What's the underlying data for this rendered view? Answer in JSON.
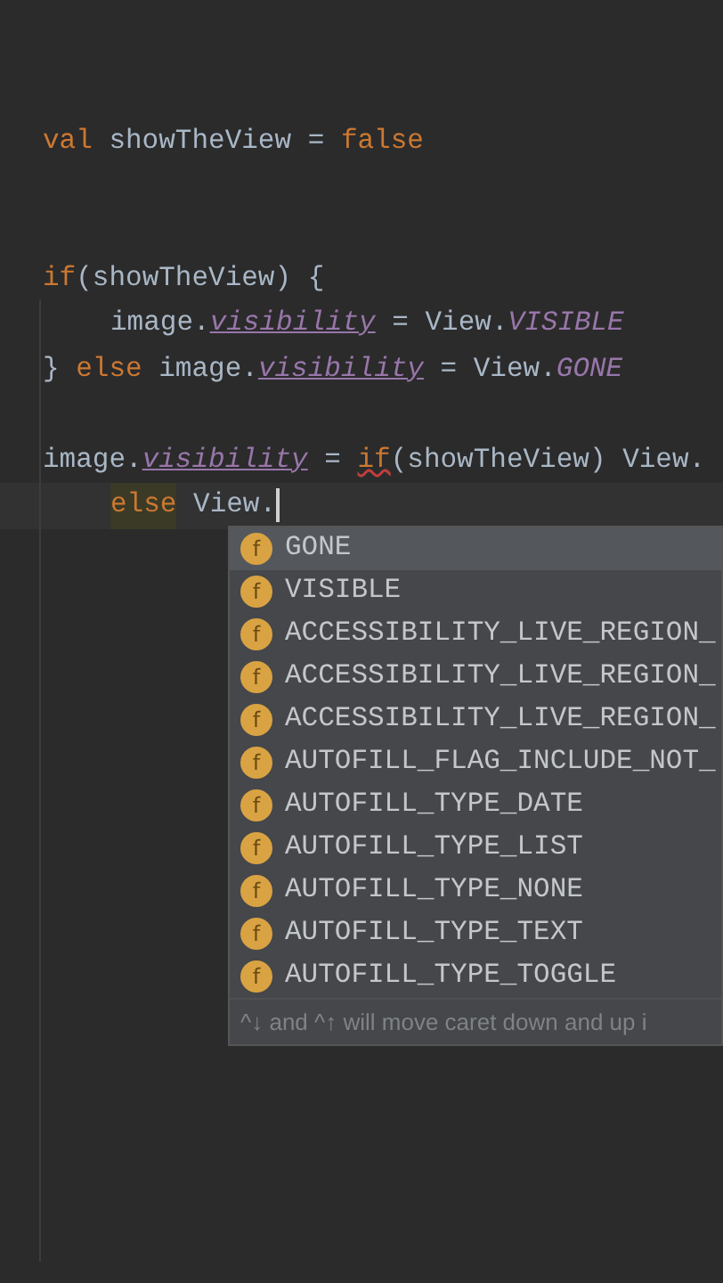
{
  "code_lines": [
    {
      "kind": "code",
      "current": false,
      "tokens": [
        {
          "text": "val",
          "kind": "keyword"
        },
        {
          "text": " showTheView = ",
          "kind": "text"
        },
        {
          "text": "false",
          "kind": "keyword"
        }
      ]
    },
    {
      "kind": "blank"
    },
    {
      "kind": "blank"
    },
    {
      "kind": "code",
      "current": false,
      "tokens": [
        {
          "text": "if",
          "kind": "keyword"
        },
        {
          "text": "(showTheView) {",
          "kind": "text"
        }
      ]
    },
    {
      "kind": "code",
      "current": false,
      "indented": true,
      "tokens": [
        {
          "text": "image.",
          "kind": "text"
        },
        {
          "text": "visibility",
          "kind": "property"
        },
        {
          "text": " = View.",
          "kind": "text"
        },
        {
          "text": "VISIBLE",
          "kind": "constant"
        }
      ]
    },
    {
      "kind": "code",
      "current": false,
      "tokens": [
        {
          "text": "} ",
          "kind": "text"
        },
        {
          "text": "else",
          "kind": "keyword"
        },
        {
          "text": " image.",
          "kind": "text"
        },
        {
          "text": "visibility",
          "kind": "property"
        },
        {
          "text": " = View.",
          "kind": "text"
        },
        {
          "text": "GONE",
          "kind": "constant"
        }
      ]
    },
    {
      "kind": "blank"
    },
    {
      "kind": "code",
      "current": false,
      "tokens": [
        {
          "text": "image.",
          "kind": "text"
        },
        {
          "text": "visibility",
          "kind": "property"
        },
        {
          "text": " = ",
          "kind": "text"
        },
        {
          "text": "if",
          "kind": "error_keyword"
        },
        {
          "text": "(showTheView) View.",
          "kind": "text"
        }
      ]
    },
    {
      "kind": "code",
      "current": true,
      "indented": true,
      "tokens": [
        {
          "text": "else",
          "kind": "highlighted_keyword"
        },
        {
          "text": " View.",
          "kind": "text"
        }
      ]
    }
  ],
  "completion_popup": {
    "items": [
      {
        "icon_letter": "f",
        "label": "GONE",
        "selected": true
      },
      {
        "icon_letter": "f",
        "label": "VISIBLE",
        "selected": false
      },
      {
        "icon_letter": "f",
        "label": "ACCESSIBILITY_LIVE_REGION_",
        "selected": false
      },
      {
        "icon_letter": "f",
        "label": "ACCESSIBILITY_LIVE_REGION_",
        "selected": false
      },
      {
        "icon_letter": "f",
        "label": "ACCESSIBILITY_LIVE_REGION_",
        "selected": false
      },
      {
        "icon_letter": "f",
        "label": "AUTOFILL_FLAG_INCLUDE_NOT_",
        "selected": false
      },
      {
        "icon_letter": "f",
        "label": "AUTOFILL_TYPE_DATE",
        "selected": false
      },
      {
        "icon_letter": "f",
        "label": "AUTOFILL_TYPE_LIST",
        "selected": false
      },
      {
        "icon_letter": "f",
        "label": "AUTOFILL_TYPE_NONE",
        "selected": false
      },
      {
        "icon_letter": "f",
        "label": "AUTOFILL_TYPE_TEXT",
        "selected": false
      },
      {
        "icon_letter": "f",
        "label": "AUTOFILL_TYPE_TOGGLE",
        "selected": false
      }
    ],
    "footer_hint": "^↓ and ^↑ will move caret down and up i"
  }
}
